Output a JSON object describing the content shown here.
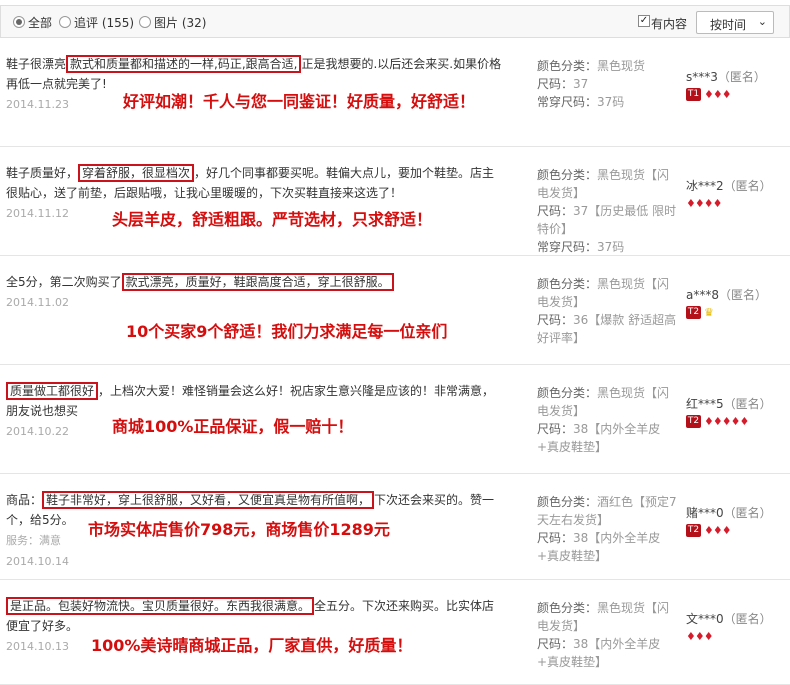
{
  "filters": {
    "all": "全部",
    "append": "追评 (155)",
    "images": "图片 (32)",
    "has_content": "有内容",
    "sort": "按时间"
  },
  "reviews": [
    {
      "pre": "鞋子很漂亮",
      "boxed": "款式和质量都和描述的一样,码正,跟高合适,",
      "post": "正是我想要的.以后还会来买.如果价格再低一点就完美了!",
      "date": "2014.11.23",
      "promo": "好评如潮！千人与您一同鉴证！好质量，好舒适！",
      "sku": [
        "颜色分类：",
        "黑色现货",
        "尺码：",
        "37",
        "常穿尺码：",
        "37码"
      ],
      "user": "s***3",
      "anon": "（匿名）",
      "level": "T1",
      "gems": "♦♦♦"
    },
    {
      "pre": "鞋子质量好，",
      "boxed": "穿着舒服，很显档次",
      "post": "，好几个同事都要买呢。鞋偏大点儿，要加个鞋垫。店主很贴心，送了前垫，后跟贴哦，让我心里暖暖的，下次买鞋直接来这选了！",
      "date": "2014.11.12",
      "promo": "头层羊皮，舒适粗跟。严苛选材，只求舒适！",
      "sku": [
        "颜色分类：",
        "黑色现货【闪电发货】",
        "尺码：",
        "37【历史最低 限时特价】",
        "常穿尺码：",
        "37码"
      ],
      "user": "冰***2",
      "anon": "（匿名）",
      "level": "",
      "gems": "♦♦♦♦"
    },
    {
      "pre": "全5分，第二次购买了",
      "boxed": "款式漂亮，质量好，鞋跟高度合适，穿上很舒服。",
      "post": "",
      "date": "2014.11.02",
      "promo": "10个买家9个舒适！我们力求满足每一位亲们",
      "sku": [
        "颜色分类：",
        "黑色现货【闪电发货】",
        "尺码：",
        "36【爆款 舒适超高好评率】",
        "",
        ""
      ],
      "user": "a***8",
      "anon": "（匿名）",
      "level": "T2",
      "gems": "♛"
    },
    {
      "pre": "",
      "boxed": "质量做工都很好",
      "post": "，上档次大爱！难怪销量会这么好！祝店家生意兴隆是应该的！非常满意，朋友说也想买",
      "date": "2014.10.22",
      "promo": "商城100%正品保证，假一赔十！",
      "sku": [
        "颜色分类：",
        "黑色现货【闪电发货】",
        "尺码：",
        "38【内外全羊皮+真皮鞋垫】",
        "",
        ""
      ],
      "user": "红***5",
      "anon": "（匿名）",
      "level": "T2",
      "gems": "♦♦♦♦♦"
    },
    {
      "pre": "商品：",
      "boxed": "鞋子非常好，穿上很舒服，又好看，又便宜真是物有所值啊，",
      "post": "下次还会来买的。赞一个，给5分。",
      "service": "服务：满意",
      "date": "2014.10.14",
      "promo": "市场实体店售价798元，商场售价1289元",
      "sku": [
        "颜色分类：",
        "酒红色【预定7天左右发货】",
        "尺码：",
        "38【内外全羊皮+真皮鞋垫】",
        "",
        ""
      ],
      "user": "赌***0",
      "anon": "（匿名）",
      "level": "T2",
      "gems": "♦♦♦"
    },
    {
      "pre": "",
      "boxed": "是正品。包装好物流快。宝贝质量很好。东西我很满意。",
      "post": "全五分。下次还来购买。比实体店便宜了好多。",
      "date": "2014.10.13",
      "promo": "100%美诗晴商城正品，厂家直供，好质量！",
      "sku": [
        "颜色分类：",
        "黑色现货【闪电发货】",
        "尺码：",
        "38【内外全羊皮+真皮鞋垫】",
        "",
        ""
      ],
      "user": "文***0",
      "anon": "（匿名）",
      "level": "",
      "gems": "♦♦♦"
    }
  ]
}
